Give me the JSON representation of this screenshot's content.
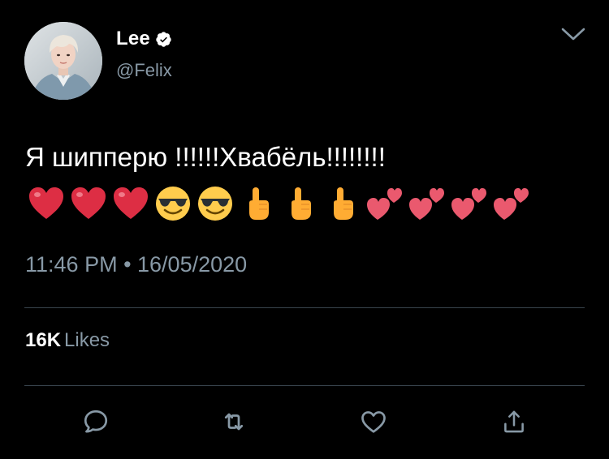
{
  "author": {
    "display_name": "Lee",
    "handle": "@Felix",
    "verified": true,
    "avatar_icon": "profile-photo"
  },
  "tweet": {
    "text": "Я шипперю !!!!!!Хвабёль!!!!!!!!",
    "emojis": [
      "red-heart",
      "red-heart",
      "red-heart",
      "smiling-face-with-sunglasses",
      "smiling-face-with-sunglasses",
      "pointing-up",
      "pointing-up",
      "pointing-up",
      "two-hearts",
      "two-hearts",
      "two-hearts",
      "two-hearts"
    ],
    "timestamp": "11:46 PM • 16/05/2020"
  },
  "stats": {
    "likes_count": "16K",
    "likes_label": "Likes"
  },
  "actions": {
    "reply_icon": "reply-icon",
    "retweet_icon": "retweet-icon",
    "like_icon": "heart-icon",
    "share_icon": "share-icon"
  },
  "colors": {
    "background": "#000000",
    "text": "#ffffff",
    "secondary_text": "#8899a6",
    "divider": "#38444d",
    "verified_badge": "#ffffff"
  }
}
